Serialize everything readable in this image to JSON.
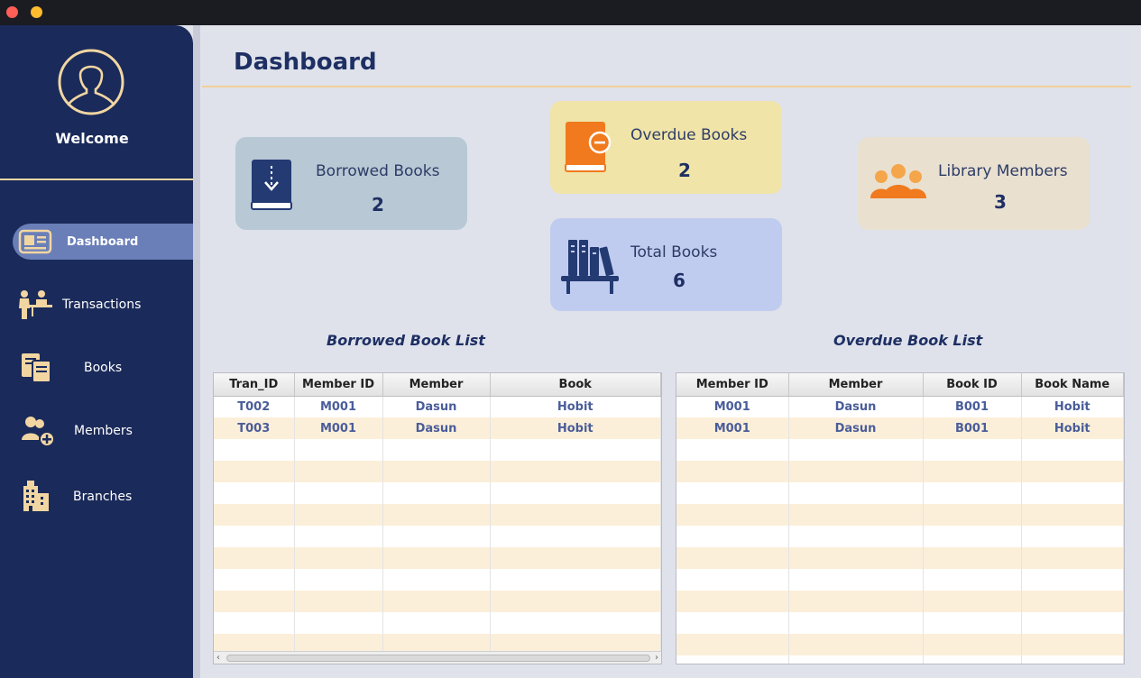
{
  "window": {
    "controls": [
      "close",
      "minimize"
    ]
  },
  "sidebar": {
    "welcome": "Welcome",
    "items": [
      {
        "label": "Dashboard",
        "icon": "dashboard-icon",
        "active": true
      },
      {
        "label": "Transactions",
        "icon": "transactions-icon",
        "active": false
      },
      {
        "label": "Books",
        "icon": "books-icon",
        "active": false
      },
      {
        "label": "Members",
        "icon": "add-member-icon",
        "active": false
      },
      {
        "label": "Branches",
        "icon": "building-icon",
        "active": false
      }
    ]
  },
  "header": {
    "title": "Dashboard"
  },
  "cards": {
    "borrowed": {
      "label": "Borrowed Books",
      "value": "2",
      "icon": "book-download-icon"
    },
    "overdue": {
      "label": "Overdue Books",
      "value": "2",
      "icon": "book-minus-icon"
    },
    "total": {
      "label": "Total Books",
      "value": "6",
      "icon": "bookshelf-icon"
    },
    "members": {
      "label": "Library Members",
      "value": "3",
      "icon": "people-icon"
    }
  },
  "borrowed_list": {
    "title": "Borrowed Book List",
    "columns": [
      "Tran_ID",
      "Member ID",
      "Member",
      "Book"
    ],
    "rows": [
      [
        "T002",
        "M001",
        "Dasun",
        "Hobit"
      ],
      [
        "T003",
        "M001",
        "Dasun",
        "Hobit"
      ]
    ]
  },
  "overdue_list": {
    "title": "Overdue Book List",
    "columns": [
      "Member ID",
      "Member",
      "Book ID",
      "Book Name"
    ],
    "rows": [
      [
        "M001",
        "Dasun",
        "B001",
        "Hobit"
      ],
      [
        "M001",
        "Dasun",
        "B001",
        "Hobit"
      ]
    ]
  },
  "colors": {
    "sidebar": "#1a2a5a",
    "accent": "#f2d6a2",
    "title": "#1e2f63",
    "row_alt": "#fcefd9"
  }
}
